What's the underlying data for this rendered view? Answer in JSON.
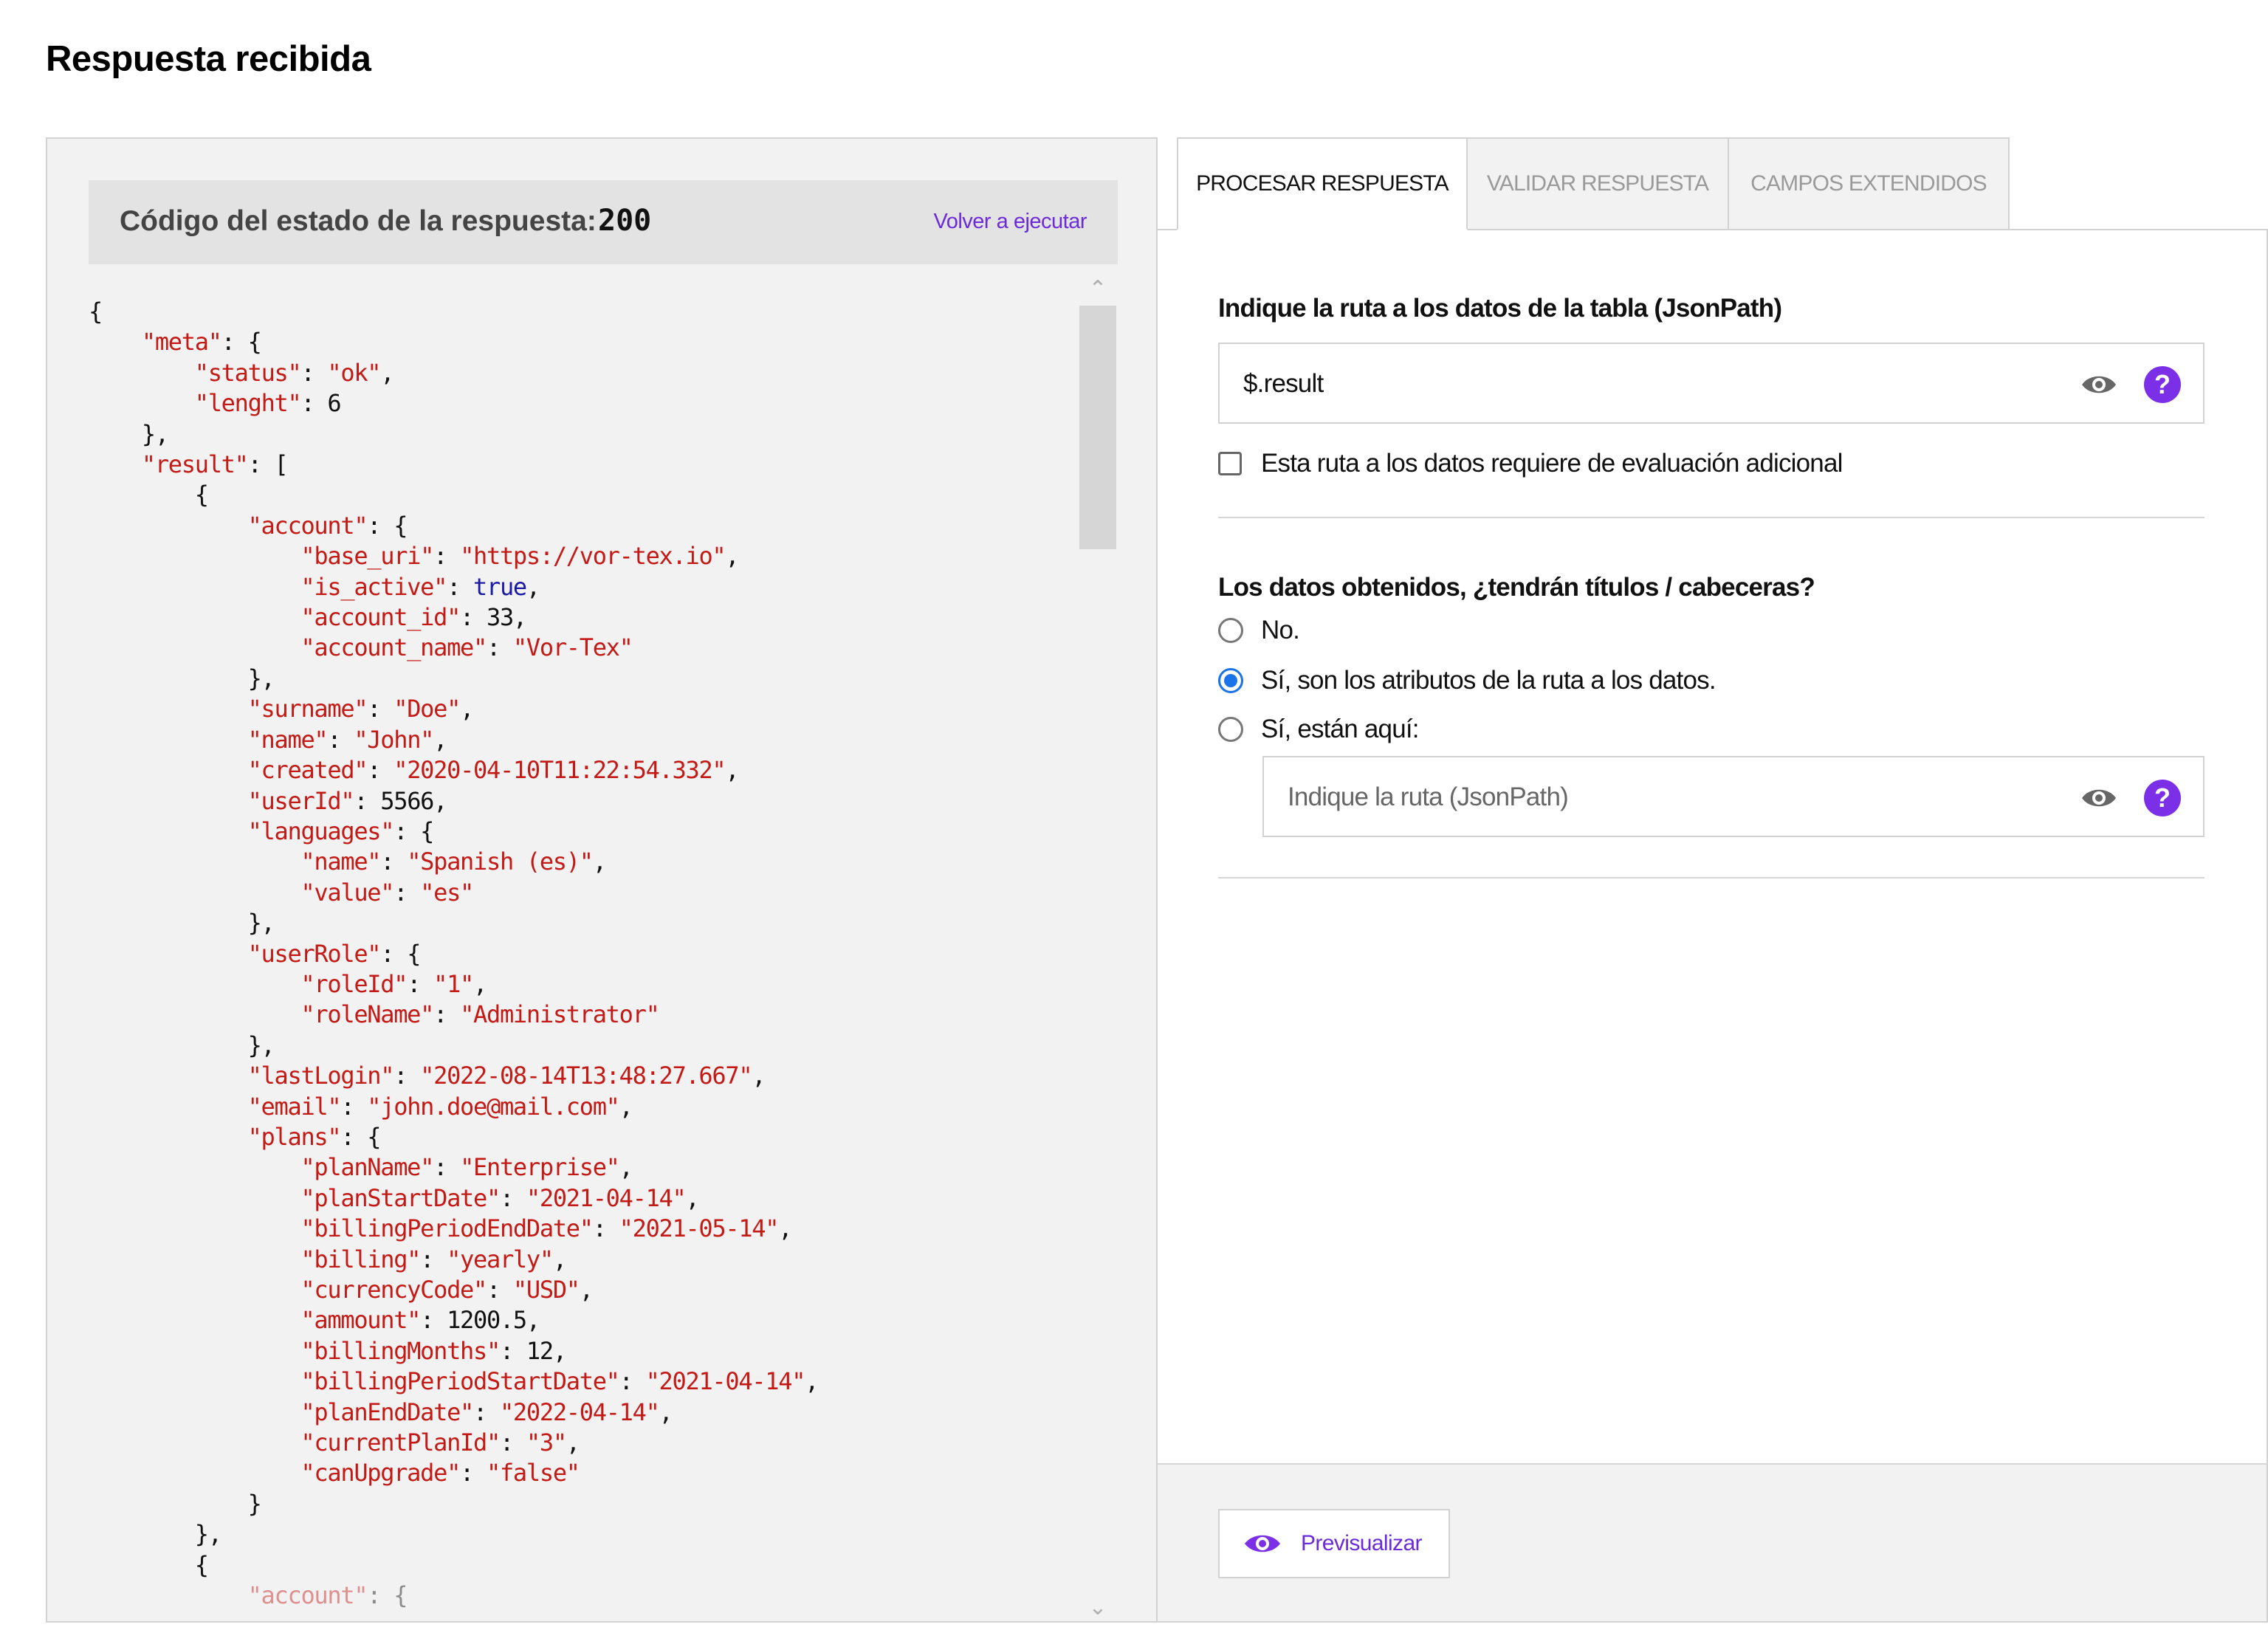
{
  "page": {
    "title": "Respuesta recibida"
  },
  "response": {
    "status_label": "Código del estado de la respuesta:",
    "status_code": "200",
    "rerun_label": "Volver a ejecutar"
  },
  "json_lines": [
    [
      [
        "p",
        "{"
      ]
    ],
    [
      [
        "p",
        "    "
      ],
      [
        "k",
        "\"meta\""
      ],
      [
        "p",
        ": {"
      ]
    ],
    [
      [
        "p",
        "        "
      ],
      [
        "k",
        "\"status\""
      ],
      [
        "p",
        ": "
      ],
      [
        "s",
        "\"ok\""
      ],
      [
        "p",
        ","
      ]
    ],
    [
      [
        "p",
        "        "
      ],
      [
        "k",
        "\"lenght\""
      ],
      [
        "p",
        ": "
      ],
      [
        "n",
        "6"
      ]
    ],
    [
      [
        "p",
        "    },"
      ]
    ],
    [
      [
        "p",
        "    "
      ],
      [
        "k",
        "\"result\""
      ],
      [
        "p",
        ": ["
      ]
    ],
    [
      [
        "p",
        "        {"
      ]
    ],
    [
      [
        "p",
        "            "
      ],
      [
        "k",
        "\"account\""
      ],
      [
        "p",
        ": {"
      ]
    ],
    [
      [
        "p",
        "                "
      ],
      [
        "k",
        "\"base_uri\""
      ],
      [
        "p",
        ": "
      ],
      [
        "s",
        "\"https://vor-tex.io\""
      ],
      [
        "p",
        ","
      ]
    ],
    [
      [
        "p",
        "                "
      ],
      [
        "k",
        "\"is_active\""
      ],
      [
        "p",
        ": "
      ],
      [
        "b",
        "true"
      ],
      [
        "p",
        ","
      ]
    ],
    [
      [
        "p",
        "                "
      ],
      [
        "k",
        "\"account_id\""
      ],
      [
        "p",
        ": "
      ],
      [
        "n",
        "33"
      ],
      [
        "p",
        ","
      ]
    ],
    [
      [
        "p",
        "                "
      ],
      [
        "k",
        "\"account_name\""
      ],
      [
        "p",
        ": "
      ],
      [
        "s",
        "\"Vor-Tex\""
      ]
    ],
    [
      [
        "p",
        "            },"
      ]
    ],
    [
      [
        "p",
        "            "
      ],
      [
        "k",
        "\"surname\""
      ],
      [
        "p",
        ": "
      ],
      [
        "s",
        "\"Doe\""
      ],
      [
        "p",
        ","
      ]
    ],
    [
      [
        "p",
        "            "
      ],
      [
        "k",
        "\"name\""
      ],
      [
        "p",
        ": "
      ],
      [
        "s",
        "\"John\""
      ],
      [
        "p",
        ","
      ]
    ],
    [
      [
        "p",
        "            "
      ],
      [
        "k",
        "\"created\""
      ],
      [
        "p",
        ": "
      ],
      [
        "s",
        "\"2020-04-10T11:22:54.332\""
      ],
      [
        "p",
        ","
      ]
    ],
    [
      [
        "p",
        "            "
      ],
      [
        "k",
        "\"userId\""
      ],
      [
        "p",
        ": "
      ],
      [
        "n",
        "5566"
      ],
      [
        "p",
        ","
      ]
    ],
    [
      [
        "p",
        "            "
      ],
      [
        "k",
        "\"languages\""
      ],
      [
        "p",
        ": {"
      ]
    ],
    [
      [
        "p",
        "                "
      ],
      [
        "k",
        "\"name\""
      ],
      [
        "p",
        ": "
      ],
      [
        "s",
        "\"Spanish (es)\""
      ],
      [
        "p",
        ","
      ]
    ],
    [
      [
        "p",
        "                "
      ],
      [
        "k",
        "\"value\""
      ],
      [
        "p",
        ": "
      ],
      [
        "s",
        "\"es\""
      ]
    ],
    [
      [
        "p",
        "            },"
      ]
    ],
    [
      [
        "p",
        "            "
      ],
      [
        "k",
        "\"userRole\""
      ],
      [
        "p",
        ": {"
      ]
    ],
    [
      [
        "p",
        "                "
      ],
      [
        "k",
        "\"roleId\""
      ],
      [
        "p",
        ": "
      ],
      [
        "s",
        "\"1\""
      ],
      [
        "p",
        ","
      ]
    ],
    [
      [
        "p",
        "                "
      ],
      [
        "k",
        "\"roleName\""
      ],
      [
        "p",
        ": "
      ],
      [
        "s",
        "\"Administrator\""
      ]
    ],
    [
      [
        "p",
        "            },"
      ]
    ],
    [
      [
        "p",
        "            "
      ],
      [
        "k",
        "\"lastLogin\""
      ],
      [
        "p",
        ": "
      ],
      [
        "s",
        "\"2022-08-14T13:48:27.667\""
      ],
      [
        "p",
        ","
      ]
    ],
    [
      [
        "p",
        "            "
      ],
      [
        "k",
        "\"email\""
      ],
      [
        "p",
        ": "
      ],
      [
        "s",
        "\"john.doe@mail.com\""
      ],
      [
        "p",
        ","
      ]
    ],
    [
      [
        "p",
        "            "
      ],
      [
        "k",
        "\"plans\""
      ],
      [
        "p",
        ": {"
      ]
    ],
    [
      [
        "p",
        "                "
      ],
      [
        "k",
        "\"planName\""
      ],
      [
        "p",
        ": "
      ],
      [
        "s",
        "\"Enterprise\""
      ],
      [
        "p",
        ","
      ]
    ],
    [
      [
        "p",
        "                "
      ],
      [
        "k",
        "\"planStartDate\""
      ],
      [
        "p",
        ": "
      ],
      [
        "s",
        "\"2021-04-14\""
      ],
      [
        "p",
        ","
      ]
    ],
    [
      [
        "p",
        "                "
      ],
      [
        "k",
        "\"billingPeriodEndDate\""
      ],
      [
        "p",
        ": "
      ],
      [
        "s",
        "\"2021-05-14\""
      ],
      [
        "p",
        ","
      ]
    ],
    [
      [
        "p",
        "                "
      ],
      [
        "k",
        "\"billing\""
      ],
      [
        "p",
        ": "
      ],
      [
        "s",
        "\"yearly\""
      ],
      [
        "p",
        ","
      ]
    ],
    [
      [
        "p",
        "                "
      ],
      [
        "k",
        "\"currencyCode\""
      ],
      [
        "p",
        ": "
      ],
      [
        "s",
        "\"USD\""
      ],
      [
        "p",
        ","
      ]
    ],
    [
      [
        "p",
        "                "
      ],
      [
        "k",
        "\"ammount\""
      ],
      [
        "p",
        ": "
      ],
      [
        "n",
        "1200.5"
      ],
      [
        "p",
        ","
      ]
    ],
    [
      [
        "p",
        "                "
      ],
      [
        "k",
        "\"billingMonths\""
      ],
      [
        "p",
        ": "
      ],
      [
        "n",
        "12"
      ],
      [
        "p",
        ","
      ]
    ],
    [
      [
        "p",
        "                "
      ],
      [
        "k",
        "\"billingPeriodStartDate\""
      ],
      [
        "p",
        ": "
      ],
      [
        "s",
        "\"2021-04-14\""
      ],
      [
        "p",
        ","
      ]
    ],
    [
      [
        "p",
        "                "
      ],
      [
        "k",
        "\"planEndDate\""
      ],
      [
        "p",
        ": "
      ],
      [
        "s",
        "\"2022-04-14\""
      ],
      [
        "p",
        ","
      ]
    ],
    [
      [
        "p",
        "                "
      ],
      [
        "k",
        "\"currentPlanId\""
      ],
      [
        "p",
        ": "
      ],
      [
        "s",
        "\"3\""
      ],
      [
        "p",
        ","
      ]
    ],
    [
      [
        "p",
        "                "
      ],
      [
        "k",
        "\"canUpgrade\""
      ],
      [
        "p",
        ": "
      ],
      [
        "s",
        "\"false\""
      ]
    ],
    [
      [
        "p",
        "            }"
      ]
    ],
    [
      [
        "p",
        "        },"
      ]
    ],
    [
      [
        "p",
        "        {"
      ]
    ],
    [
      [
        "p",
        "            "
      ],
      [
        "k",
        "\"account\""
      ],
      [
        "p",
        ": {"
      ]
    ]
  ],
  "tabs": [
    {
      "label": "PROCESAR RESPUESTA",
      "active": true
    },
    {
      "label": "VALIDAR RESPUESTA",
      "active": false
    },
    {
      "label": "CAMPOS EXTENDIDOS",
      "active": false
    }
  ],
  "process": {
    "path_title": "Indique la ruta a los datos de la tabla (JsonPath)",
    "path_value": "$.result",
    "extra_eval_label": "Esta ruta a los datos requiere de evaluación adicional",
    "extra_eval_checked": false,
    "headers_title": "Los datos obtenidos, ¿tendrán títulos / cabeceras?",
    "headers_options": [
      {
        "label": "No.",
        "checked": false
      },
      {
        "label": "Sí, son los atributos de la ruta a los datos.",
        "checked": true
      },
      {
        "label": "Sí, están aquí:",
        "checked": false
      }
    ],
    "headers_path_placeholder": "Indique la ruta (JsonPath)",
    "help_glyph": "?"
  },
  "footer": {
    "preview_label": "Previsualizar"
  },
  "icons": {
    "eye": "eye-icon",
    "help": "help-icon",
    "chevron_up": "chevron-up-icon",
    "chevron_down": "chevron-down-icon"
  },
  "colors": {
    "accent": "#6c2bd9",
    "help_bg": "#7b2fe6",
    "json_key": "#c41a16",
    "json_bool": "#1a1aa6",
    "radio_checked": "#1a73e8"
  }
}
